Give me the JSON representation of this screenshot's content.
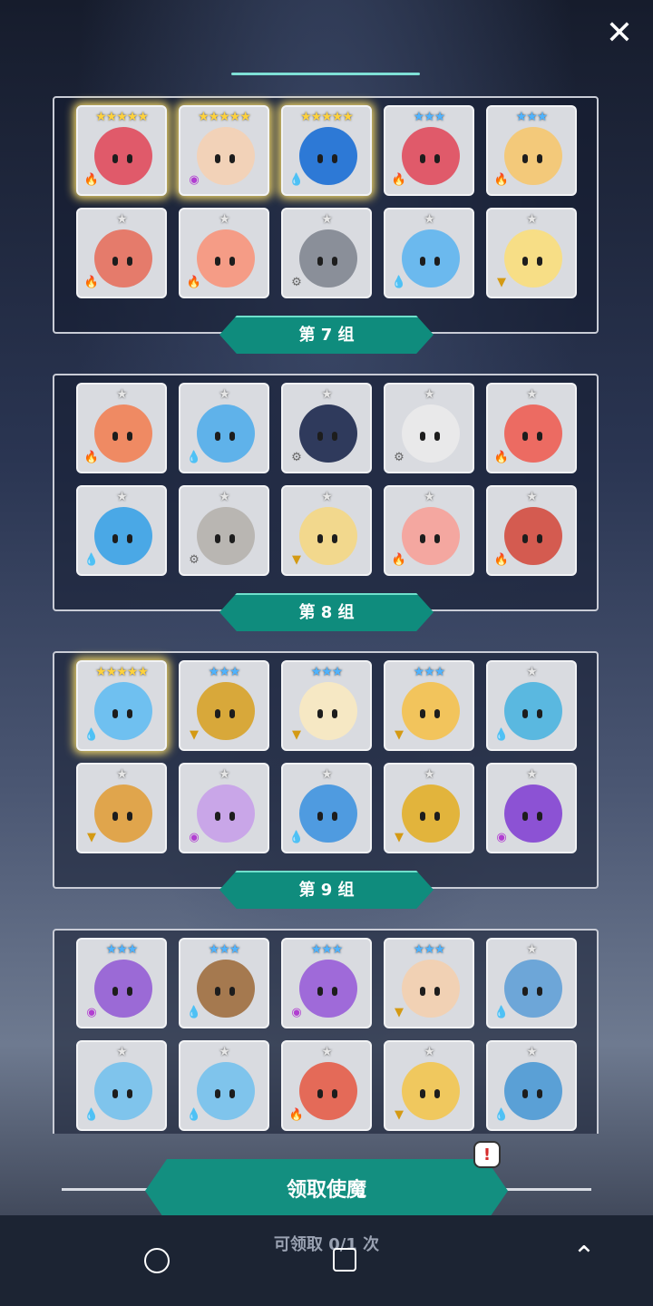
{
  "close_icon": "close-icon",
  "groups": [
    {
      "label": "第 7 组"
    },
    {
      "label": "第 8 组"
    },
    {
      "label": "第 9 组"
    }
  ],
  "claim": {
    "button_label": "领取使魔",
    "count_text": "可领取 0/1 次",
    "alert": "!"
  },
  "colors": {
    "accent": "#138f80",
    "banner": "#0f8c7d",
    "gold_glow": "#f5d96a"
  },
  "rows": [
    {
      "stars": [
        "★★★★★",
        "★★★★★",
        "★★★★★",
        "★★★",
        "★★★"
      ]
    },
    {
      "stars": [
        "★",
        "★",
        "★",
        "★",
        "★"
      ]
    },
    {
      "stars": [
        "★",
        "★",
        "★",
        "★",
        "★"
      ]
    },
    {
      "stars": [
        "★",
        "★",
        "★",
        "★",
        "★"
      ]
    },
    {
      "stars": [
        "★★★★★",
        "★★★",
        "★★★",
        "★★★",
        "★"
      ]
    },
    {
      "stars": [
        "★",
        "★",
        "★",
        "★",
        "★"
      ]
    },
    {
      "stars": [
        "★★★",
        "★★★",
        "★★★",
        "★★★",
        "★"
      ]
    },
    {
      "stars": [
        "★",
        "★",
        "★",
        "★",
        "★"
      ]
    }
  ]
}
